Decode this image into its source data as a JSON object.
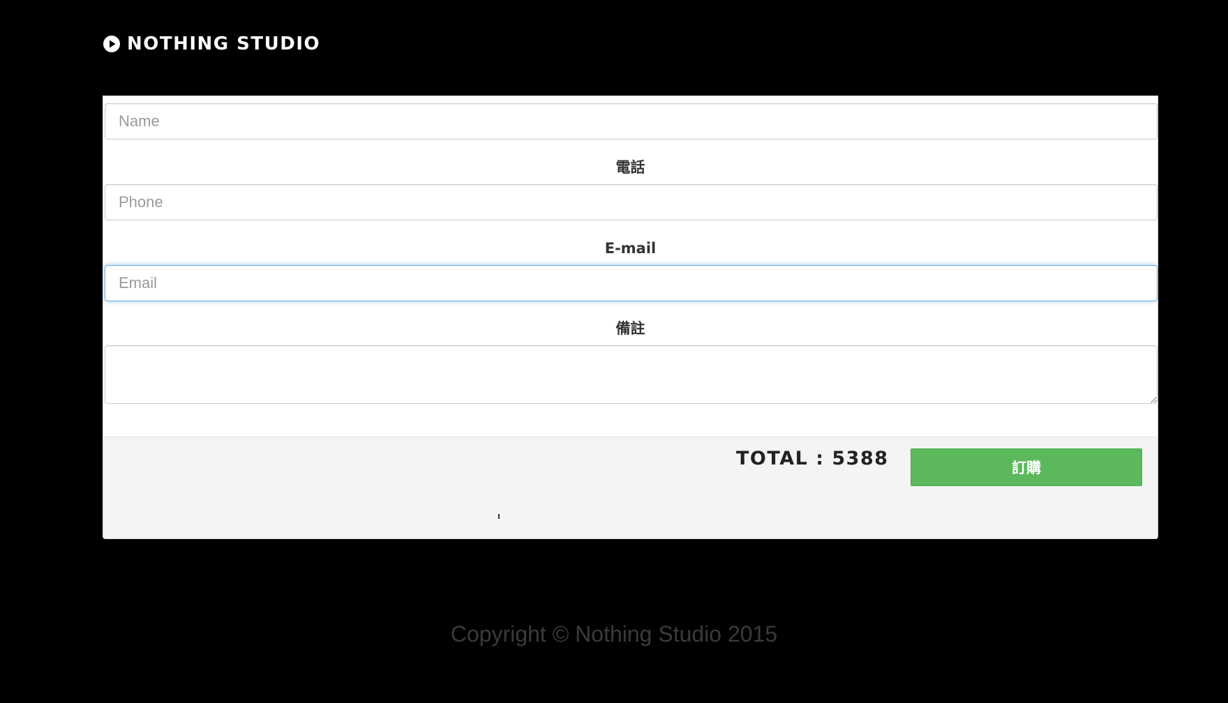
{
  "brand": {
    "name": "NOTHING STUDIO",
    "icon": "play-circle-icon"
  },
  "form": {
    "name_field": {
      "placeholder": "Name",
      "value": ""
    },
    "phone_label": "電話",
    "phone_field": {
      "placeholder": "Phone",
      "value": ""
    },
    "email_label": "E-mail",
    "email_field": {
      "placeholder": "Email",
      "value": "",
      "focused": true
    },
    "note_label": "備註",
    "note_field": {
      "value": ""
    }
  },
  "summary": {
    "total_text": "TOTAL : 5388",
    "order_button_label": "訂購"
  },
  "footer": {
    "copyright": "Copyright © Nothing Studio 2015"
  },
  "colors": {
    "background": "#000000",
    "order_button": "#5cb85c",
    "focus_border": "#66afe9"
  }
}
